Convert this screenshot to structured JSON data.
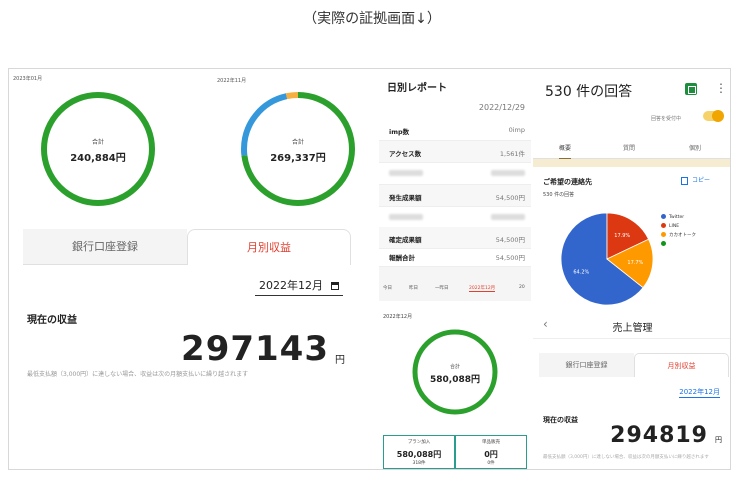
{
  "caption": "（実際の証拠画面↓）",
  "panel_a": {
    "date_left": "2023年01月",
    "date_right": "2022年11月",
    "donut_left": {
      "label": "合計",
      "value": "240,884円",
      "fraction": 1.0,
      "color": "#2ca02c"
    },
    "donut_right": {
      "label": "合計",
      "value": "269,337円",
      "segments": [
        {
          "fraction": 0.73,
          "color": "#2ca02c"
        },
        {
          "fraction": 0.235,
          "color": "#3498db"
        },
        {
          "fraction": 0.035,
          "color": "#f5b041"
        }
      ]
    },
    "tab_bank": "銀行口座登録",
    "tab_monthly": "月別収益",
    "selected_month": "2022年12月",
    "current_label": "現在の収益",
    "current_value": "297143",
    "unit": "円",
    "note": "最低支払額（3,000円）に達しない場合、収益は次の月額支払いに繰り越されます"
  },
  "panel_b": {
    "title": "日別レポート",
    "date": "2022/12/29",
    "rows": [
      {
        "label": "imp数",
        "value": "0imp"
      },
      {
        "label": "アクセス数",
        "value": "1,561件"
      },
      {
        "label": "",
        "value": ""
      },
      {
        "label": "発生成果額",
        "value": "54,500円"
      },
      {
        "label": "",
        "value": ""
      },
      {
        "label": "確定成果額",
        "value": "54,500円"
      },
      {
        "label": "報酬合計",
        "value": "54,500円"
      }
    ],
    "nav": [
      "今日",
      "昨日",
      "一昨日",
      "2022年12月",
      "20"
    ],
    "month_label": "2022年12月",
    "donut": {
      "label": "合計",
      "value": "580,088円",
      "fraction": 1.0,
      "color": "#2ca02c"
    },
    "stat_left": {
      "label": "プラン加入",
      "value": "580,088円",
      "sub": "318件"
    },
    "stat_right": {
      "label": "単品販売",
      "value": "0円",
      "sub": "0件"
    }
  },
  "panel_c": {
    "title": "530 件の回答",
    "accepting": "回答を受付中",
    "tabs": [
      "概要",
      "質問",
      "個別"
    ],
    "question": "ご希望の連絡先",
    "copy": "コピー",
    "count": "530 件の回答",
    "pie_labels": [
      "17.9%",
      "17.7%",
      "64.2%"
    ],
    "legend": [
      {
        "name": "Twitter",
        "color": "#3366cc"
      },
      {
        "name": "LINE",
        "color": "#dc3912"
      },
      {
        "name": "カカオトーク",
        "color": "#ff9900"
      },
      {
        "name": "",
        "color": "#109618"
      }
    ],
    "nav_back": "‹",
    "nav_title": "売上管理",
    "tab_bank": "銀行口座登録",
    "tab_monthly": "月別収益",
    "selected_month": "2022年12月",
    "current_label": "現在の収益",
    "current_value": "294819",
    "unit": "円",
    "note": "最低支払額（3,000円）に達しない場合、収益は次の月額支払いに繰り越されます"
  },
  "chart_data": {
    "type": "pie",
    "title": "ご希望の連絡先",
    "categories": [
      "Twitter",
      "LINE",
      "カカオトーク"
    ],
    "values": [
      64.2,
      17.9,
      17.7
    ],
    "colors": [
      "#3366cc",
      "#dc3912",
      "#ff9900"
    ],
    "legend": "right"
  }
}
